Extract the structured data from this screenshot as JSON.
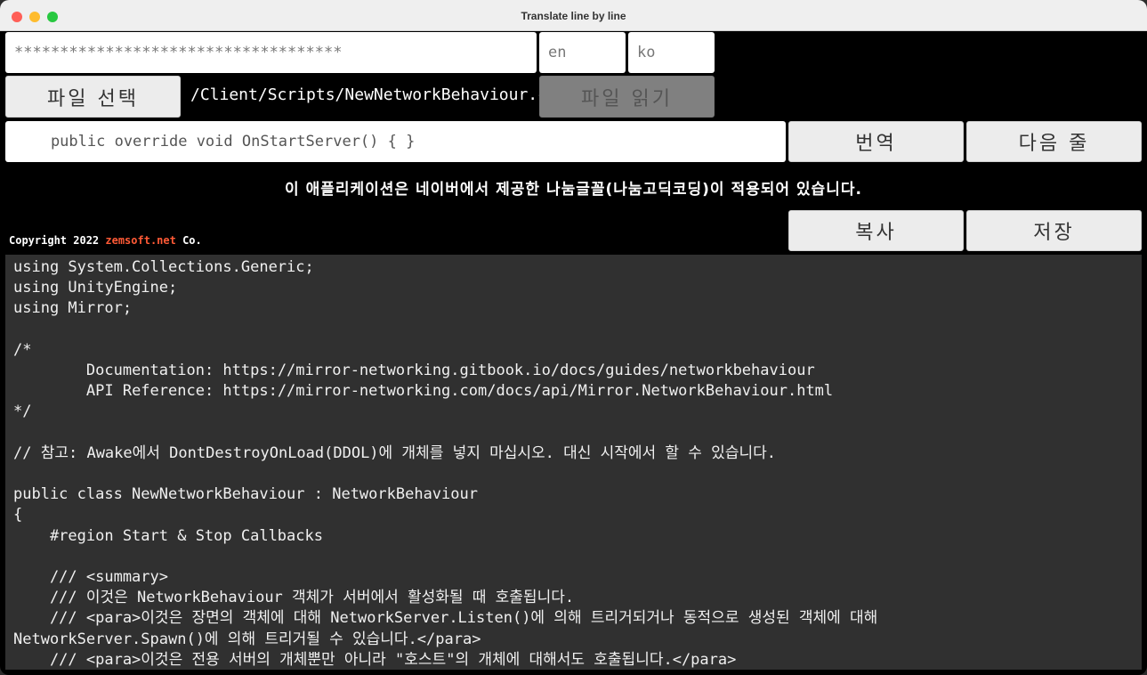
{
  "window": {
    "title": "Translate line by line"
  },
  "api_key": {
    "value": "************************************"
  },
  "source_lang": {
    "value": "en"
  },
  "target_lang": {
    "value": "ko"
  },
  "file_select_button": "파일 선택",
  "file_path": "/Client/Scripts/NewNetworkBehaviour.cs",
  "file_read_button": "파일 읽기",
  "current_line": {
    "value": "    public override void OnStartServer() { }"
  },
  "translate_button": "번역",
  "next_line_button": "다음 줄",
  "notice": "이 애플리케이션은 네이버에서 제공한 나눔글꼴(나눔고딕코딩)이 적용되어 있습니다.",
  "copyright": {
    "prefix": "Copyright 2022 ",
    "link": "zemsoft.net",
    "suffix": " Co."
  },
  "copy_button": "복사",
  "save_button": "저장",
  "code_text": "using System.Collections.Generic;\nusing UnityEngine;\nusing Mirror;\n\n/*\n\tDocumentation: https://mirror-networking.gitbook.io/docs/guides/networkbehaviour\n\tAPI Reference: https://mirror-networking.com/docs/api/Mirror.NetworkBehaviour.html\n*/\n\n// 참고: Awake에서 DontDestroyOnLoad(DDOL)에 개체를 넣지 마십시오. 대신 시작에서 할 수 있습니다.\n\npublic class NewNetworkBehaviour : NetworkBehaviour\n{\n    #region Start & Stop Callbacks\n\n    /// <summary>\n    /// 이것은 NetworkBehaviour 객체가 서버에서 활성화될 때 호출됩니다.\n    /// <para>이것은 장면의 객체에 대해 NetworkServer.Listen()에 의해 트리거되거나 동적으로 생성된 객체에 대해\nNetworkServer.Spawn()에 의해 트리거될 수 있습니다.</para>\n    /// <para>이것은 전용 서버의 개체뿐만 아니라 \"호스트\"의 개체에 대해서도 호출됩니다.</para>"
}
